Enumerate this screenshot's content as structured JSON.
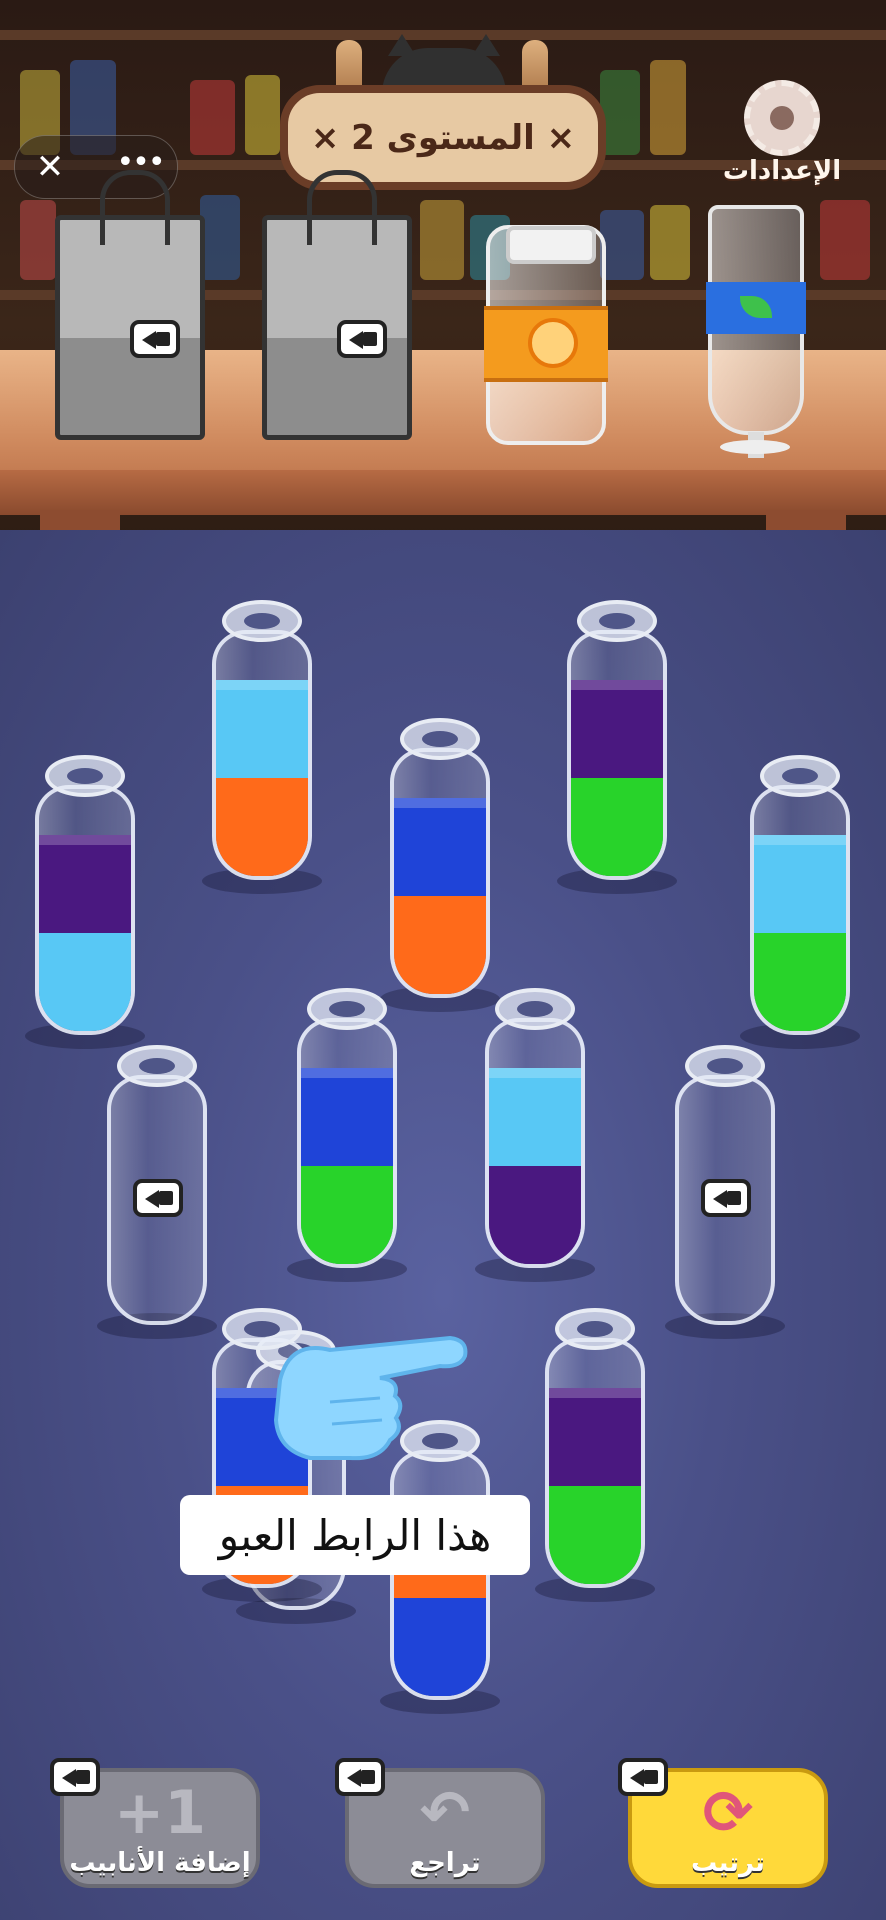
{
  "close_glyph": "✕",
  "more_glyph": "•••",
  "level_sign": "× المستوى 2 ×",
  "settings_label": "الإعدادات",
  "caption": "هذا الرابط العبو",
  "tubes": [
    {
      "layers": [],
      "locked": false
    },
    {
      "layers": [
        "#ff6a1a",
        "#58c8f5"
      ],
      "locked": false
    },
    {
      "layers": [
        "#ff6a1a",
        "#1f44d8"
      ],
      "locked": false
    },
    {
      "layers": [
        "#28d32a",
        "#4a1880"
      ],
      "locked": false
    },
    {
      "layers": [
        "#58c8f5",
        "#4a1880"
      ],
      "locked": false
    },
    {
      "layers": [
        "#28d32a",
        "#58c8f5"
      ],
      "locked": false
    },
    {
      "layers": [],
      "locked": true
    },
    {
      "layers": [
        "#28d32a",
        "#1f44d8"
      ],
      "locked": false
    },
    {
      "layers": [
        "#4a1880",
        "#58c8f5"
      ],
      "locked": false
    },
    {
      "layers": [],
      "locked": true
    },
    {
      "layers": [
        "#1f44d8",
        "#ff6a1a"
      ],
      "locked": false
    },
    {
      "layers": [
        "#28d32a",
        "#4a1880"
      ],
      "locked": false
    },
    {
      "layers": [
        "#ff6a1a",
        "#1f44d8"
      ],
      "locked": false
    }
  ],
  "bottom_buttons": [
    {
      "label": "إضافة الأنابيب",
      "icon": "add-tube-icon",
      "color": "#8c8c96"
    },
    {
      "label": "تراجع",
      "icon": "undo-icon",
      "color": "#8c8c96"
    },
    {
      "label": "ترتيب",
      "icon": "shuffle-icon",
      "color": "#ffd93a"
    }
  ],
  "colors": {
    "floor": "#4a5088",
    "accent": "#ffd93a"
  }
}
